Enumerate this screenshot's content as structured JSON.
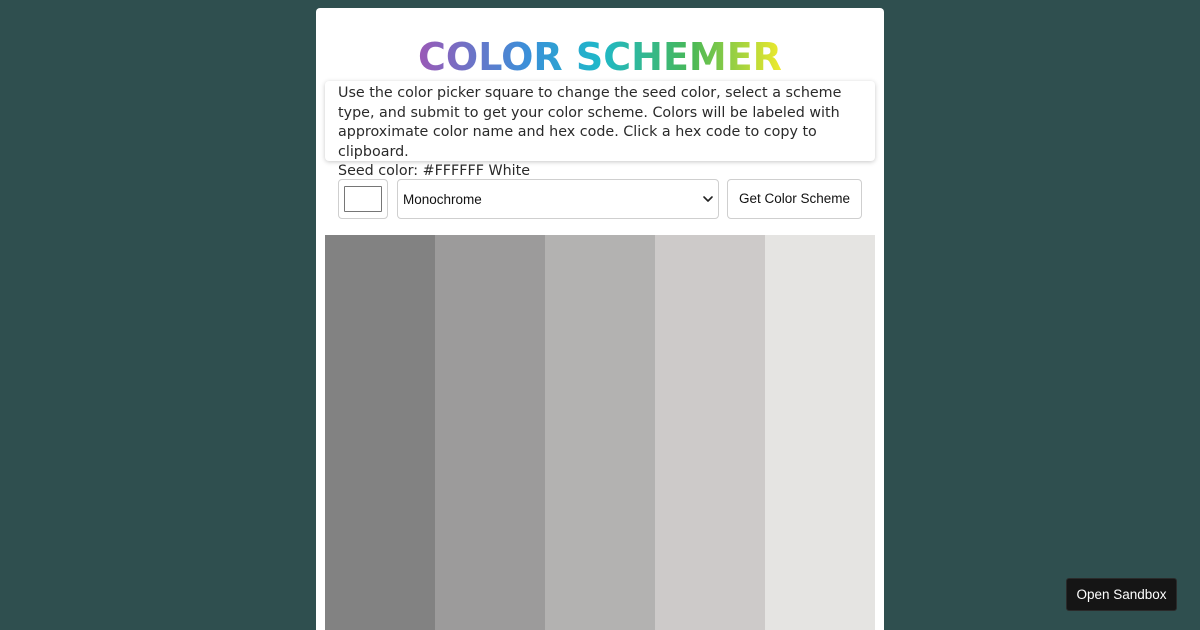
{
  "header": {
    "title": "COLOR SCHEMER"
  },
  "instructions": {
    "text": "Use the color picker square to change the seed color, select a scheme type, and submit to get your color scheme. Colors will be labeled with approximate color name and hex code. Click a hex code to copy to clipboard.",
    "seed_label": "Seed color: #FFFFFF White"
  },
  "controls": {
    "seed_color": "#FFFFFF",
    "scheme_type": "Monochrome",
    "submit_label": "Get Color Scheme"
  },
  "scheme": {
    "colors": [
      "#828282",
      "#9c9b9b",
      "#b3b2b1",
      "#cdcac9",
      "#e5e4e2"
    ]
  },
  "sandbox": {
    "label": "Open Sandbox"
  },
  "colors": {
    "page_background": "#2f4f4f",
    "card_background": "#ffffff"
  }
}
